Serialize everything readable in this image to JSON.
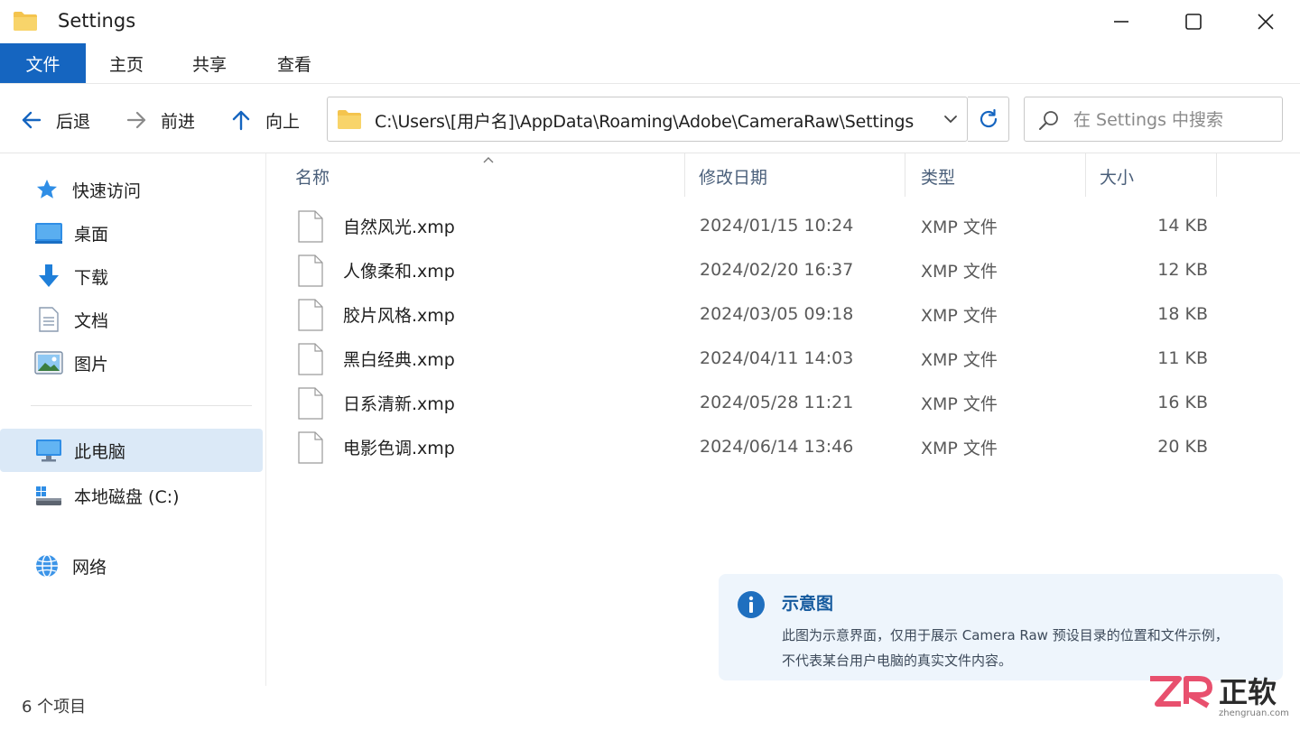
{
  "window": {
    "title": "Settings",
    "controls": [
      "minimize",
      "maximize",
      "close"
    ]
  },
  "ribbon": {
    "tabs": [
      {
        "label": "文件",
        "active": true
      },
      {
        "label": "主页",
        "active": false
      },
      {
        "label": "共享",
        "active": false
      },
      {
        "label": "查看",
        "active": false
      }
    ]
  },
  "nav": {
    "back_label": "后退",
    "forward_label": "前进",
    "up_label": "向上",
    "address": "C:\\Users\\[用户名]\\AppData\\Roaming\\Adobe\\CameraRaw\\Settings",
    "search_placeholder": "在 Settings 中搜索"
  },
  "sidebar": {
    "items": [
      {
        "label": "快速访问",
        "icon": "star-icon"
      },
      {
        "label": "桌面",
        "icon": "desktop-icon"
      },
      {
        "label": "下载",
        "icon": "download-icon"
      },
      {
        "label": "文档",
        "icon": "document-icon"
      },
      {
        "label": "图片",
        "icon": "pictures-icon"
      },
      {
        "label": "此电脑",
        "icon": "computer-icon",
        "selected": true
      },
      {
        "label": "本地磁盘 (C:)",
        "icon": "drive-icon"
      },
      {
        "label": "网络",
        "icon": "network-icon"
      }
    ]
  },
  "columns": {
    "name": "名称",
    "date": "修改日期",
    "type": "类型",
    "size": "大小"
  },
  "files": [
    {
      "name": "自然风光.xmp",
      "date": "2024/01/15  10:24",
      "type": "XMP  文件",
      "size": "14 KB"
    },
    {
      "name": "人像柔和.xmp",
      "date": "2024/02/20  16:37",
      "type": "XMP  文件",
      "size": "12 KB"
    },
    {
      "name": "胶片风格.xmp",
      "date": "2024/03/05  09:18",
      "type": "XMP  文件",
      "size": "18 KB"
    },
    {
      "name": "黑白经典.xmp",
      "date": "2024/04/11  14:03",
      "type": "XMP  文件",
      "size": "11 KB"
    },
    {
      "name": "日系清新.xmp",
      "date": "2024/05/28  11:21",
      "type": "XMP  文件",
      "size": "16 KB"
    },
    {
      "name": "电影色调.xmp",
      "date": "2024/06/14  13:46",
      "type": "XMP  文件",
      "size": "20 KB"
    }
  ],
  "info": {
    "title": "示意图",
    "line1": "此图为示意界面，仅用于展示 Camera Raw 预设目录的位置和文件示例，",
    "line2": "不代表某台用户电脑的真实文件内容。"
  },
  "status": {
    "count": "6 个项目"
  },
  "watermark": {
    "text": "ZR 正软",
    "site": "zhengruan.com"
  },
  "colors": {
    "accent": "#1565c0",
    "selected_bg": "#dbe9f7",
    "info_bg": "#eef5fc",
    "folder": "#f4c44e"
  }
}
